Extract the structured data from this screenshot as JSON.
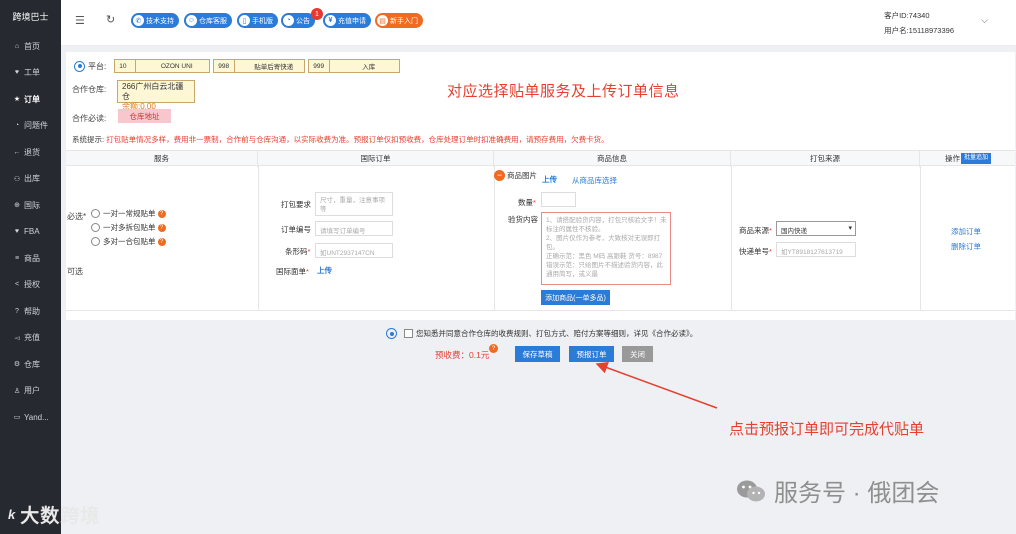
{
  "sidebar": {
    "brand": "跨境巴士",
    "items": [
      {
        "label": "首页",
        "icon": "home-icon",
        "glyph": "⌂"
      },
      {
        "label": "工单",
        "icon": "heart-icon",
        "glyph": "♥"
      },
      {
        "label": "订单",
        "icon": "star-icon",
        "glyph": "★"
      },
      {
        "label": "问题件",
        "icon": "box-icon",
        "glyph": "◔"
      },
      {
        "label": "退货",
        "icon": "return-icon",
        "glyph": "←"
      },
      {
        "label": "出库",
        "icon": "outbound-icon",
        "glyph": "⚇"
      },
      {
        "label": "国际",
        "icon": "globe-icon",
        "glyph": "⊕"
      },
      {
        "label": "FBA",
        "icon": "fba-icon",
        "glyph": "♥"
      },
      {
        "label": "商品",
        "icon": "goods-icon",
        "glyph": "≡"
      },
      {
        "label": "授权",
        "icon": "share-icon",
        "glyph": "<"
      },
      {
        "label": "帮助",
        "icon": "help-icon",
        "glyph": "?"
      },
      {
        "label": "充值",
        "icon": "recharge-icon",
        "glyph": "◅"
      },
      {
        "label": "仓库",
        "icon": "gear-icon",
        "glyph": "⚙"
      },
      {
        "label": "用户",
        "icon": "user-icon",
        "glyph": "♙"
      },
      {
        "label": "Yand...",
        "icon": "yandex-icon",
        "glyph": "▭"
      }
    ],
    "active_index": 2
  },
  "topbar": {
    "pills": [
      {
        "label": "技术支持",
        "glyph": "✆",
        "color": "blue"
      },
      {
        "label": "仓库客服",
        "glyph": "☺",
        "color": "blue"
      },
      {
        "label": "手机版",
        "glyph": "▯",
        "color": "blue"
      },
      {
        "label": "公告",
        "glyph": "◔",
        "color": "blue"
      },
      {
        "label": "充值申请",
        "glyph": "¥",
        "color": "blue"
      },
      {
        "label": "新手入门",
        "glyph": "▤",
        "color": "orange"
      }
    ],
    "notice_badge": "1",
    "customer_id": "客户ID:74340",
    "username": "用户名:15118973396"
  },
  "form": {
    "platform_label": "平台:",
    "platform_boxes": [
      {
        "code": "10",
        "name": "OZON UNI"
      },
      {
        "code": "998",
        "name": "贴单后寄快递"
      },
      {
        "code": "999",
        "name": "入库"
      }
    ],
    "warehouse_label": "合作仓库:",
    "warehouse_name": "266广州白云北疆仓",
    "warehouse_balance": "余额:0.00",
    "must_read_label": "合作必读:",
    "warehouse_address_button": "仓库地址",
    "annotation_title": "对应选择贴单服务及上传订单信息",
    "system_tip_label": "系统提示:",
    "system_tip_text": "打包贴单情况多样，费用非一票制，合作前与仓库沟通，以实际收费为准。预报订单仅扣预收费，仓库处理订单时扣准确费用，请预存费用，欠费卡货。"
  },
  "table": {
    "headers": {
      "service": "服务",
      "intl_order": "国际订单",
      "product_info": "商品信息",
      "pack_source": "打包来源",
      "action": "操作"
    },
    "batch_add_label": "批量追加",
    "service": {
      "required_label": "必选*",
      "options": [
        "一对一常规贴单",
        "一对多拆包贴单",
        "多对一合包贴单"
      ],
      "optional_label": "可选"
    },
    "intl_order": {
      "pack_req_label": "打包要求",
      "pack_req_placeholder": "尺寸，重量，注意事项等",
      "order_no_label": "订单编号",
      "order_no_placeholder": "请填写订单编号",
      "barcode_label": "条形码",
      "barcode_placeholder": "如UNT2937147CN",
      "intl_sheet_label": "国际面单",
      "upload_label": "上传"
    },
    "product_info": {
      "image_label": "商品图片",
      "upload_label": "上传",
      "from_library_label": "从商品库选择",
      "qty_label": "数量",
      "inspect_label": "验货内容",
      "inspect_placeholder_lines": [
        "1、请搭配验货内容，打包只核验文字！未",
        "标注的属性不核验。",
        "2、图片仅作为参考，大致核对无误即打",
        "包。",
        "正确示范：黑色 M码 高跟鞋 货号：8987",
        "错误示范：只给图片不描述验货内容，此",
        "通用简写，或义最"
      ],
      "add_product_button": "添加商品(一单多品)"
    },
    "pack_source": {
      "source_label": "商品来源",
      "source_value": "国内快递",
      "tracking_label": "快递单号",
      "tracking_placeholder": "如YT8918127613719"
    },
    "actions": {
      "add_order": "添加订单",
      "delete_order": "删除订单"
    }
  },
  "footer": {
    "agree_text": "您知悉并同意合作仓库的收费规则、打包方式、赔付方案等细则，详见《合作必读》。",
    "prepaid_fee": "预收费：0.1元",
    "fee_badge": "?",
    "save_draft_button": "保存草稿",
    "submit_button": "预报订单",
    "close_button": "关闭",
    "annotation_bottom": "点击预报订单即可完成代贴单"
  },
  "watermarks": {
    "wechat_text": "服务号 · 俄团会",
    "brand_text": "大数跨境",
    "brand_prefix": "k"
  },
  "colors": {
    "sidebar_bg": "#26292f",
    "accent_blue": "#2b7bd8",
    "accent_orange": "#f06a21",
    "annotation_red": "#e64032"
  }
}
